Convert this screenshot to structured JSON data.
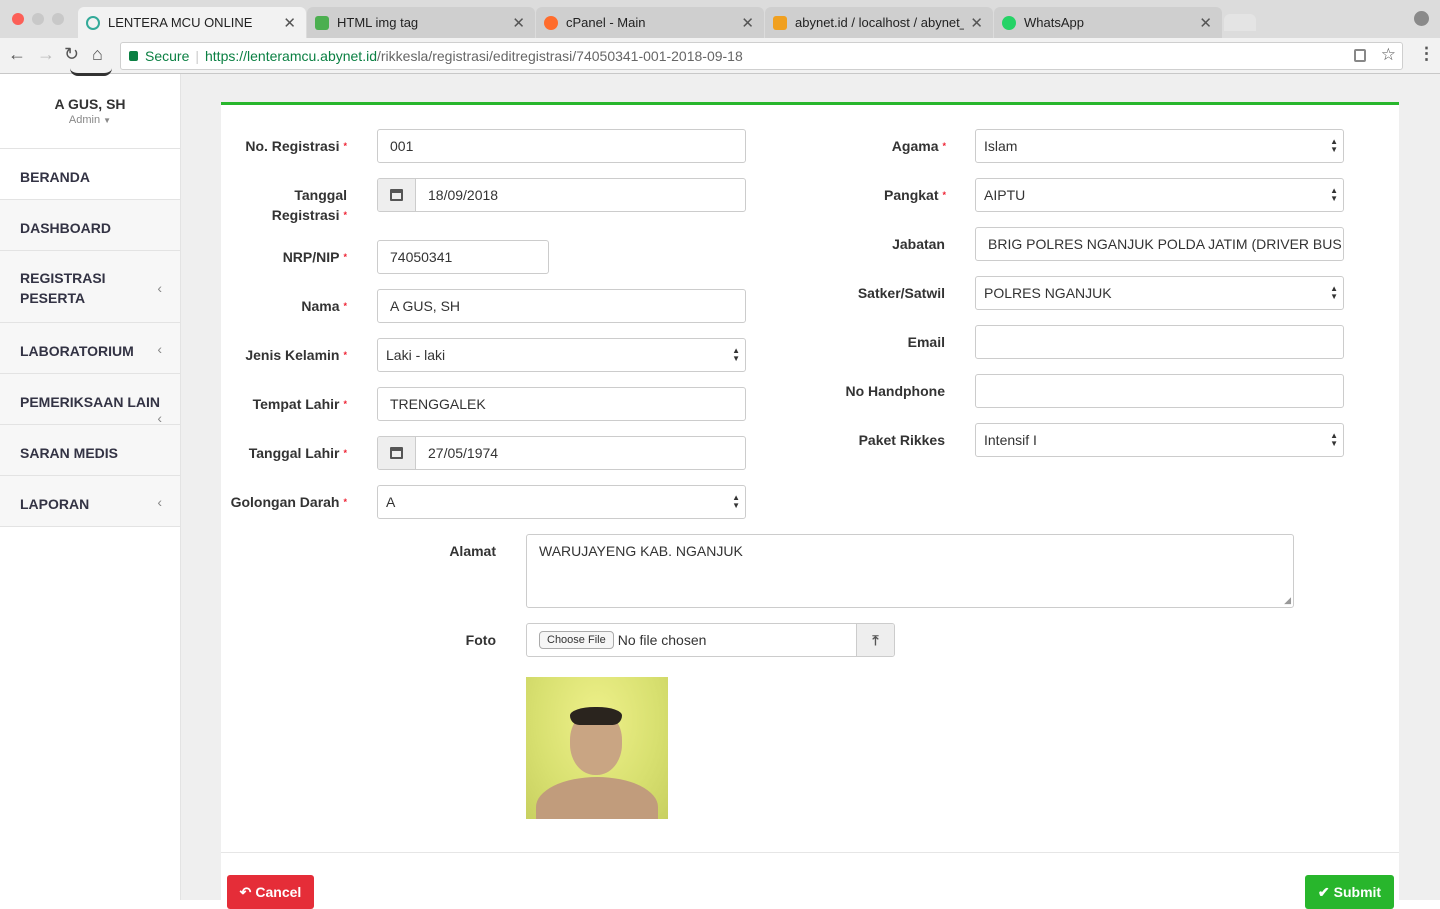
{
  "browser": {
    "tabs": [
      {
        "title": "LENTERA MCU ONLINE",
        "active": true,
        "icon": "lentera-icon"
      },
      {
        "title": "HTML img tag",
        "active": false,
        "icon": "w3-icon"
      },
      {
        "title": "cPanel - Main",
        "active": false,
        "icon": "cpanel-icon"
      },
      {
        "title": "abynet.id / localhost / abynet_l",
        "active": false,
        "icon": "phpmyadmin-icon"
      },
      {
        "title": "WhatsApp",
        "active": false,
        "icon": "whatsapp-icon"
      }
    ],
    "secure_label": "Secure",
    "url_host": "https://lenteramcu.abynet.id",
    "url_path": "/rikkesla/registrasi/editregistrasi/74050341-001-2018-09-18"
  },
  "sidebar": {
    "user_name": "A GUS, SH",
    "user_role": "Admin",
    "items": [
      {
        "label": "BERANDA",
        "submenu": false
      },
      {
        "label": "DASHBOARD",
        "submenu": false
      },
      {
        "label": "REGISTRASI PESERTA",
        "submenu": true
      },
      {
        "label": "LABORATORIUM",
        "submenu": true
      },
      {
        "label": "PEMERIKSAAN LAIN",
        "submenu": true
      },
      {
        "label": "SARAN MEDIS",
        "submenu": false
      },
      {
        "label": "LAPORAN",
        "submenu": true
      }
    ]
  },
  "form": {
    "no_registrasi": {
      "label": "No. Registrasi",
      "value": "001"
    },
    "tanggal_registrasi": {
      "label_line1": "Tanggal",
      "label_line2": "Registrasi",
      "value": "18/09/2018"
    },
    "nrp_nip": {
      "label": "NRP/NIP",
      "value": "74050341"
    },
    "nama": {
      "label": "Nama",
      "value": "A GUS, SH"
    },
    "jenis_kelamin": {
      "label": "Jenis Kelamin",
      "value": "Laki - laki"
    },
    "tempat_lahir": {
      "label": "Tempat Lahir",
      "value": "TRENGGALEK"
    },
    "tanggal_lahir": {
      "label": "Tanggal Lahir",
      "value": "27/05/1974"
    },
    "golongan_darah": {
      "label": "Golongan Darah",
      "value": "A"
    },
    "agama": {
      "label": "Agama",
      "value": "Islam"
    },
    "pangkat": {
      "label": "Pangkat",
      "value": "AIPTU"
    },
    "jabatan": {
      "label": "Jabatan",
      "value": "BRIG POLRES NGANJUK POLDA JATIM (DRIVER BUS"
    },
    "satker": {
      "label": "Satker/Satwil",
      "value": "POLRES NGANJUK"
    },
    "email": {
      "label": "Email",
      "value": ""
    },
    "no_handphone": {
      "label": "No Handphone",
      "value": ""
    },
    "paket_rikkes": {
      "label": "Paket Rikkes",
      "value": "Intensif I"
    },
    "alamat": {
      "label": "Alamat",
      "value": "WARUJAYENG KAB. NGANJUK"
    },
    "foto": {
      "label": "Foto",
      "choose_label": "Choose File",
      "status": "No file chosen"
    },
    "required_mark": "*"
  },
  "actions": {
    "cancel_label": "Cancel",
    "submit_label": "Submit"
  },
  "colors": {
    "accent_green": "#28b62c",
    "cancel_red": "#e52d38",
    "required_red": "#e23333"
  }
}
